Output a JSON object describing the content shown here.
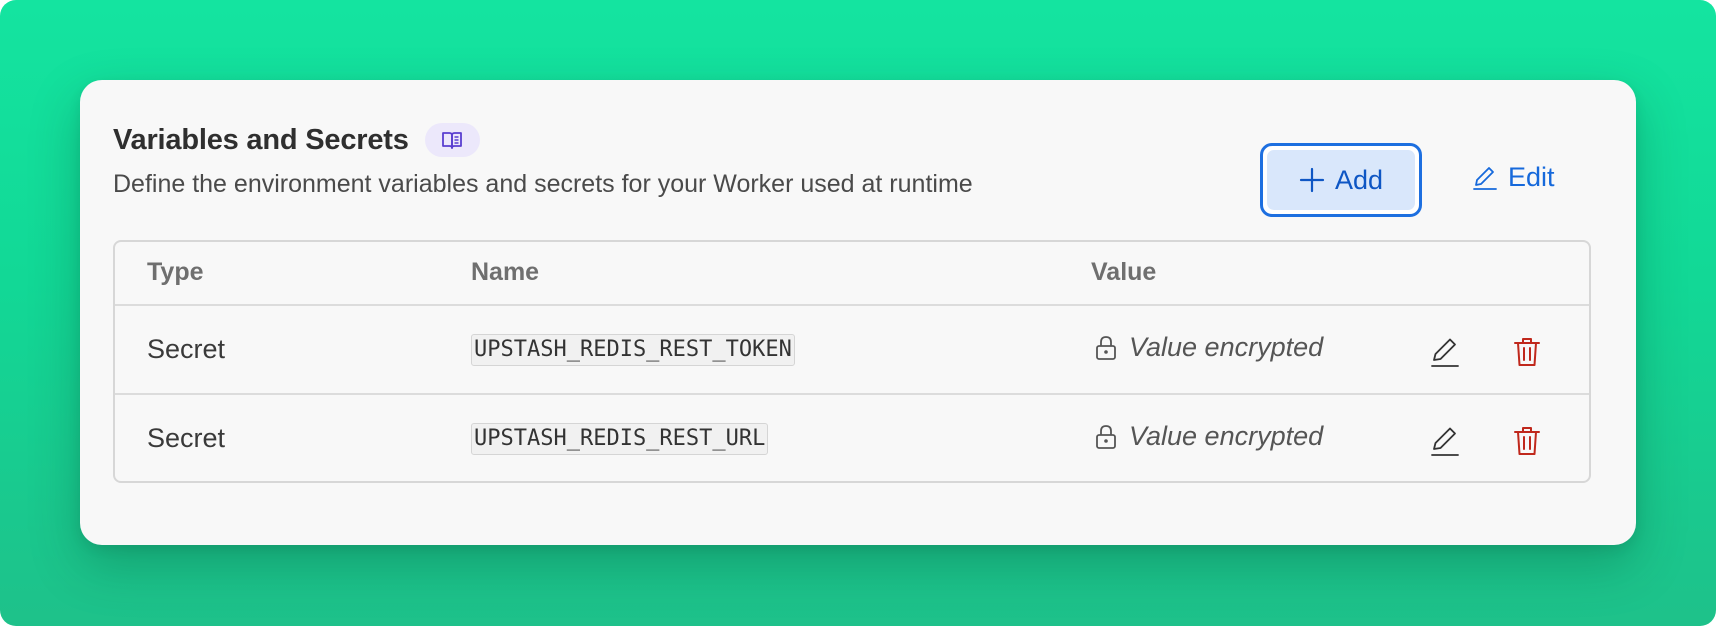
{
  "header": {
    "title": "Variables and Secrets",
    "description": "Define the environment variables and secrets for your Worker used at runtime",
    "docs_icon": "book-open-icon"
  },
  "actions": {
    "add_label": "Add",
    "edit_label": "Edit"
  },
  "table": {
    "columns": [
      "Type",
      "Name",
      "Value"
    ],
    "rows": [
      {
        "type": "Secret",
        "name": "UPSTASH_REDIS_REST_TOKEN",
        "value": "Value encrypted"
      },
      {
        "type": "Secret",
        "name": "UPSTASH_REDIS_REST_URL",
        "value": "Value encrypted"
      }
    ]
  },
  "colors": {
    "background": "#14e4a0",
    "accent": "#1669db",
    "add_fill": "#d9e7fb",
    "delete": "#c0281c",
    "badge": "#ece8fb"
  }
}
